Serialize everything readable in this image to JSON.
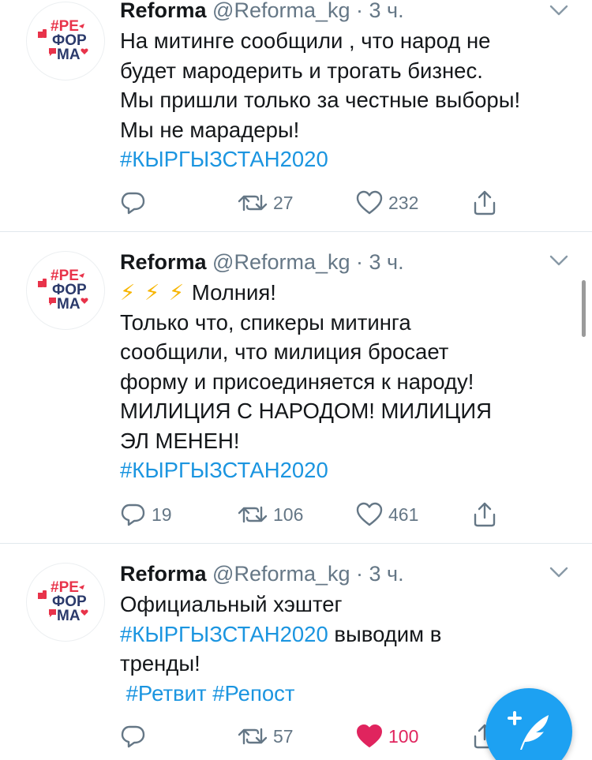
{
  "tweets": [
    {
      "name": "Reforma",
      "handle": "@Reforma_kg",
      "time": "· 3 ч.",
      "lines": [
        "На митинге сообщили , что народ не",
        "будет мародерить и трогать бизнес.",
        "Мы пришли только за честные выборы!",
        "Мы не марадеры!"
      ],
      "hashtag_line": "#КЫРГЫЗСТАН2020",
      "reply_count": "",
      "retweet_count": "27",
      "like_count": "232",
      "liked": false
    },
    {
      "name": "Reforma",
      "handle": "@Reforma_kg",
      "time": "· 3 ч.",
      "lightning": "⚡ ⚡ ⚡",
      "first_line_text": "Молния!",
      "lines": [
        "Только что, спикеры митинга",
        "сообщили, что милиция бросает",
        "форму и присоединяется к народу!",
        "МИЛИЦИЯ С НАРОДОМ! МИЛИЦИЯ",
        "ЭЛ МЕНЕН!"
      ],
      "hashtag_line": "#КЫРГЫЗСТАН2020",
      "reply_count": "19",
      "retweet_count": "106",
      "like_count": "461",
      "liked": false
    },
    {
      "name": "Reforma",
      "handle": "@Reforma_kg",
      "time": "· 3 ч.",
      "lines": [
        "Официальный хэштег"
      ],
      "hashtag_inline": "#КЫРГЫЗСТАН2020",
      "after_hashtag": " выводим в",
      "line3": "тренды!",
      "hashtag_last": " #Ретвит #Репост",
      "reply_count": "",
      "retweet_count": "57",
      "like_count": "100",
      "liked": true
    }
  ],
  "avatar": {
    "line1": "#РЕ",
    "line2": "ФОР",
    "line3": "МА",
    "colors": {
      "red": "#e8334a",
      "navy": "#2b3a6b"
    }
  },
  "colors": {
    "accent": "#1da1f2",
    "hashtag": "#1b95e0",
    "muted": "#657786",
    "like_active": "#e0245e",
    "separator": "#e1e8ed"
  },
  "icons": {
    "reply": "reply-icon",
    "retweet": "retweet-icon",
    "like": "heart-icon",
    "share": "share-icon",
    "caret": "chevron-down-icon",
    "compose": "compose-tweet-icon"
  }
}
